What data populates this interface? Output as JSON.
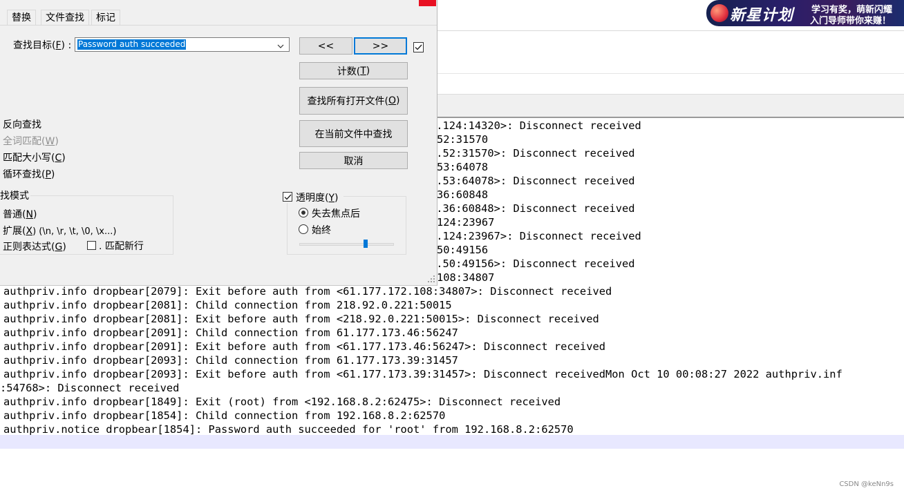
{
  "banner": {
    "title": "新星计划",
    "line1": "学习有奖，萌新闪耀",
    "line2": "入门导师带你来赚！"
  },
  "editor": {
    "lines": [
      {
        "text": "2.124:14320>: Disconnect received"
      },
      {
        "text": "52:31570"
      },
      {
        "text": "3.52:31570>: Disconnect received"
      },
      {
        "text": "53:64078"
      },
      {
        "text": "3.53:64078>: Disconnect received"
      },
      {
        "text": "36:60848"
      },
      {
        "text": "3.36:60848>: Disconnect received"
      },
      {
        "text": "124:23967"
      },
      {
        "text": "2.124:23967>: Disconnect received"
      },
      {
        "text": "50:49156"
      },
      {
        "text": "3.50:49156>: Disconnect received"
      },
      {
        "text": "108:34807"
      },
      {
        "text": "authpriv.info dropbear[2079]: Exit before auth from <61.177.172.108:34807>: Disconnect received"
      },
      {
        "text": "authpriv.info dropbear[2081]: Child connection from 218.92.0.221:50015"
      },
      {
        "text": "authpriv.info dropbear[2081]: Exit before auth from <218.92.0.221:50015>: Disconnect received"
      },
      {
        "text": "authpriv.info dropbear[2091]: Child connection from 61.177.173.46:56247"
      },
      {
        "text": "authpriv.info dropbear[2091]: Exit before auth from <61.177.173.46:56247>: Disconnect received"
      },
      {
        "text": "authpriv.info dropbear[2093]: Child connection from 61.177.173.39:31457"
      },
      {
        "text": "authpriv.info dropbear[2093]: Exit before auth from <61.177.173.39:31457>: Disconnect receivedMon Oct 10 00:08:27 2022 authpriv.inf"
      },
      {
        "text": ":54768>: Disconnect received"
      },
      {
        "text": "authpriv.info dropbear[1849]: Exit (root) from <192.168.8.2:62475>: Disconnect received"
      },
      {
        "text": "authpriv.info dropbear[1854]: Child connection from 192.168.8.2:62570"
      },
      {
        "text": "authpriv.notice dropbear[1854]: Password auth succeeded for 'root' from 192.168.8.2:62570"
      }
    ]
  },
  "dialog": {
    "tabs": [
      "替换",
      "文件查找",
      "标记"
    ],
    "find_label": "查找目标(",
    "find_label_key": "F",
    "find_label_end": ") :",
    "find_value": "Password auth succeeded",
    "prev_button": "<<",
    "next_button": ">>",
    "count_button": "计数(",
    "count_key": "T",
    "find_all_open_button": "查找所有打开文件(",
    "find_all_open_key": "O",
    "find_in_current_button": "在当前文件中查找",
    "cancel_button": "取消",
    "options": {
      "reverse": "反向查找",
      "whole_word": "全词匹配(",
      "whole_word_key": "W",
      "match_case": "匹配大小写(",
      "match_case_key": "C",
      "wrap": "循环查找(",
      "wrap_key": "P"
    },
    "search_mode": {
      "title": "找模式",
      "normal": "普通(",
      "normal_key": "N",
      "extended": "扩展(",
      "extended_key": "X",
      "extended_hint": ") (\\n, \\r, \\t, \\0, \\x...)",
      "regex": "正则表达式(",
      "regex_key": "G",
      "newline": ". 匹配新行"
    },
    "transparency": {
      "title": "透明度(",
      "title_key": "Y",
      "on_lose_focus": "失去焦点后",
      "always": "始终",
      "level": 0.7
    }
  },
  "watermark": "CSDN @keNn9s"
}
